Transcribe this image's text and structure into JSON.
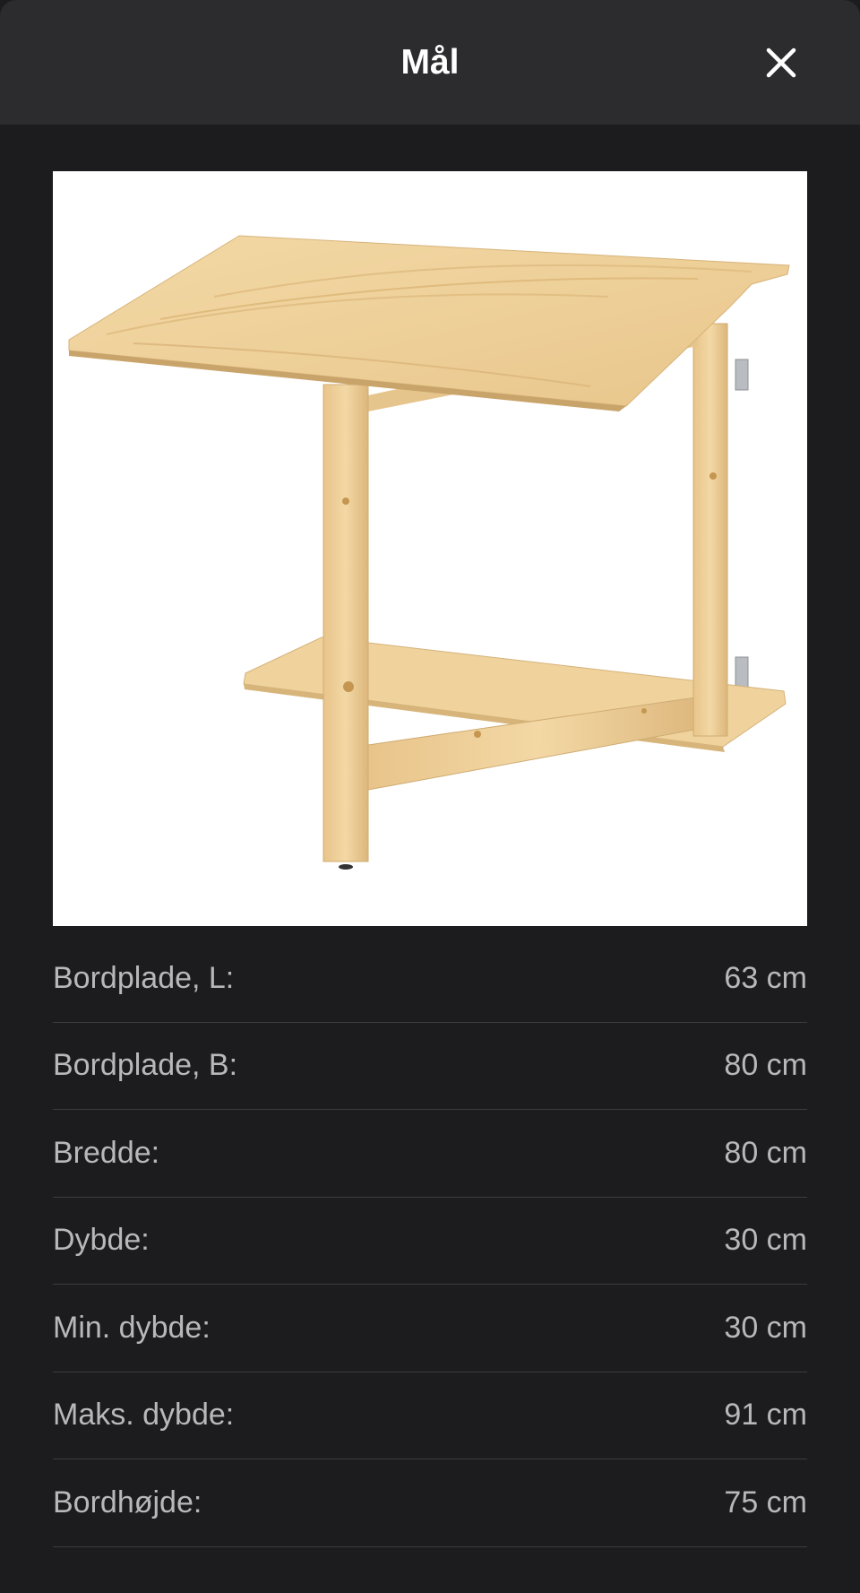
{
  "header": {
    "title": "Mål",
    "close_icon": "close-icon"
  },
  "product_image": {
    "description_icon": "product-image"
  },
  "dimensions": [
    {
      "label": "Bordplade, L:",
      "value": "63 cm"
    },
    {
      "label": "Bordplade, B:",
      "value": "80 cm"
    },
    {
      "label": "Bredde:",
      "value": "80 cm"
    },
    {
      "label": "Dybde:",
      "value": "30 cm"
    },
    {
      "label": "Min. dybde:",
      "value": "30 cm"
    },
    {
      "label": "Maks. dybde:",
      "value": "91 cm"
    },
    {
      "label": "Bordhøjde:",
      "value": "75 cm"
    }
  ]
}
